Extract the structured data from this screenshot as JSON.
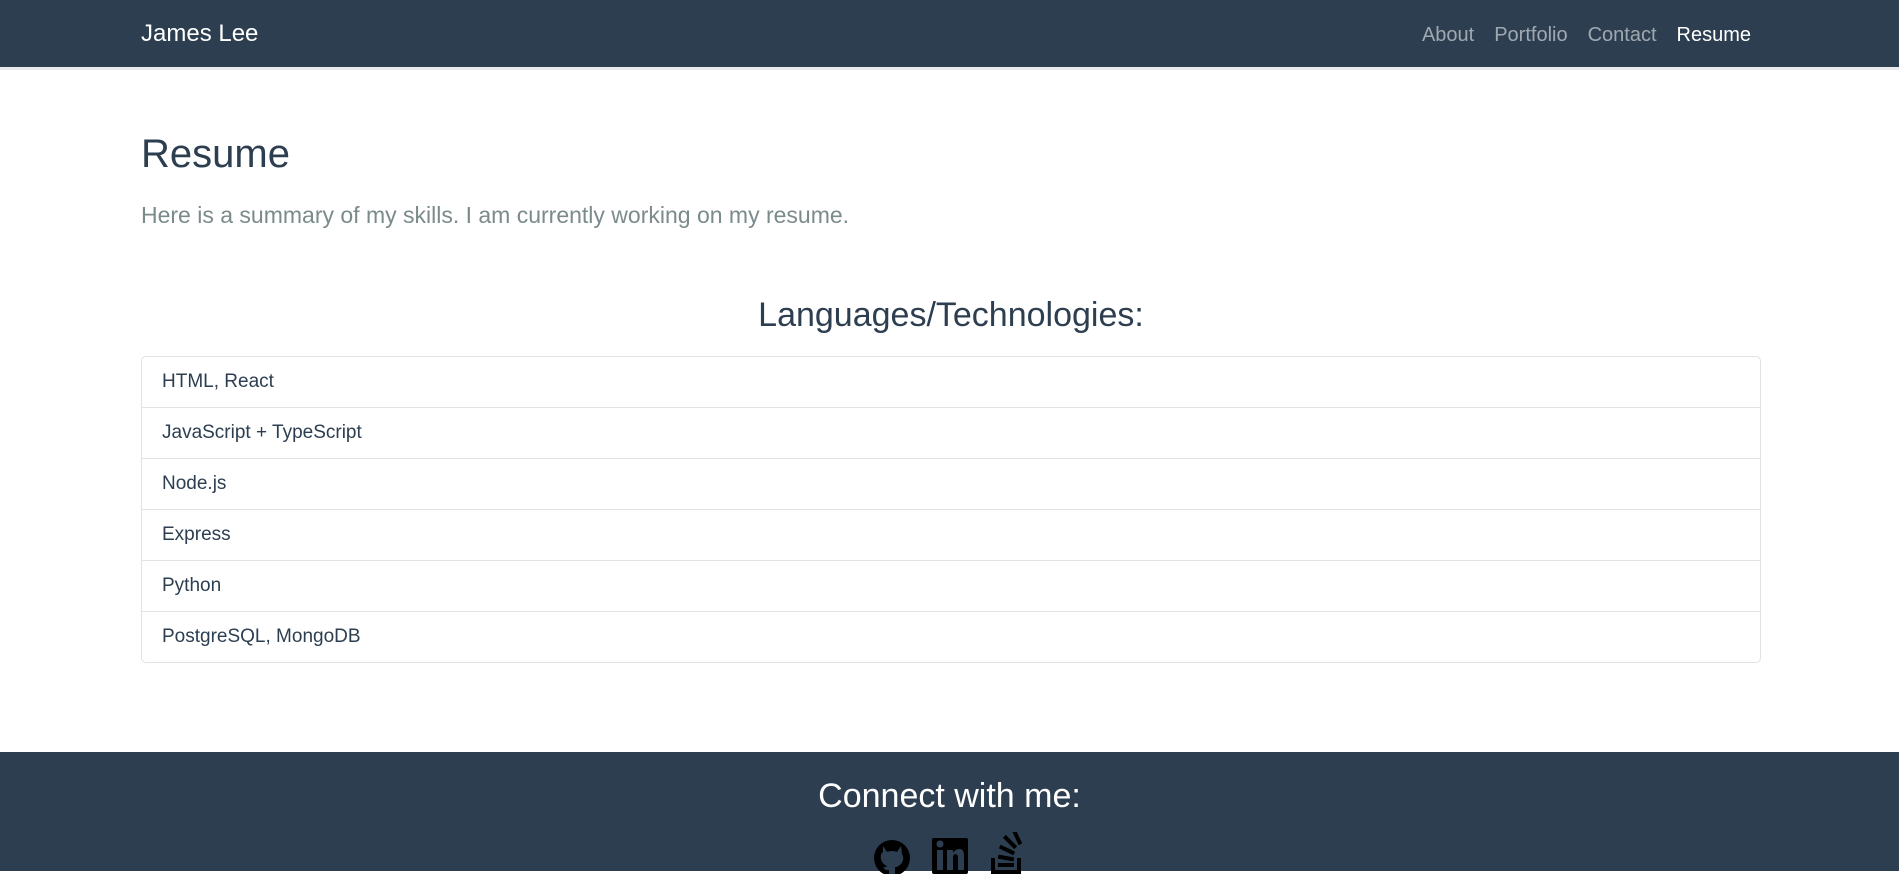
{
  "navbar": {
    "brand": "James Lee",
    "links": [
      {
        "label": "About"
      },
      {
        "label": "Portfolio"
      },
      {
        "label": "Contact"
      },
      {
        "label": "Resume",
        "active": true
      }
    ]
  },
  "main": {
    "title": "Resume",
    "lead": "Here is a summary of my skills. I am currently working on my resume.",
    "section_title": "Languages/Technologies:",
    "skills": [
      "HTML, React",
      "JavaScript + TypeScript",
      "Node.js",
      "Express",
      "Python",
      "PostgreSQL, MongoDB"
    ]
  },
  "footer": {
    "title": "Connect with me:",
    "icons": [
      "github-icon",
      "linkedin-icon",
      "stackoverflow-icon"
    ]
  },
  "colors": {
    "primary": "#2c3e50",
    "muted": "#7b8a8b",
    "border": "#dfe3e6"
  }
}
